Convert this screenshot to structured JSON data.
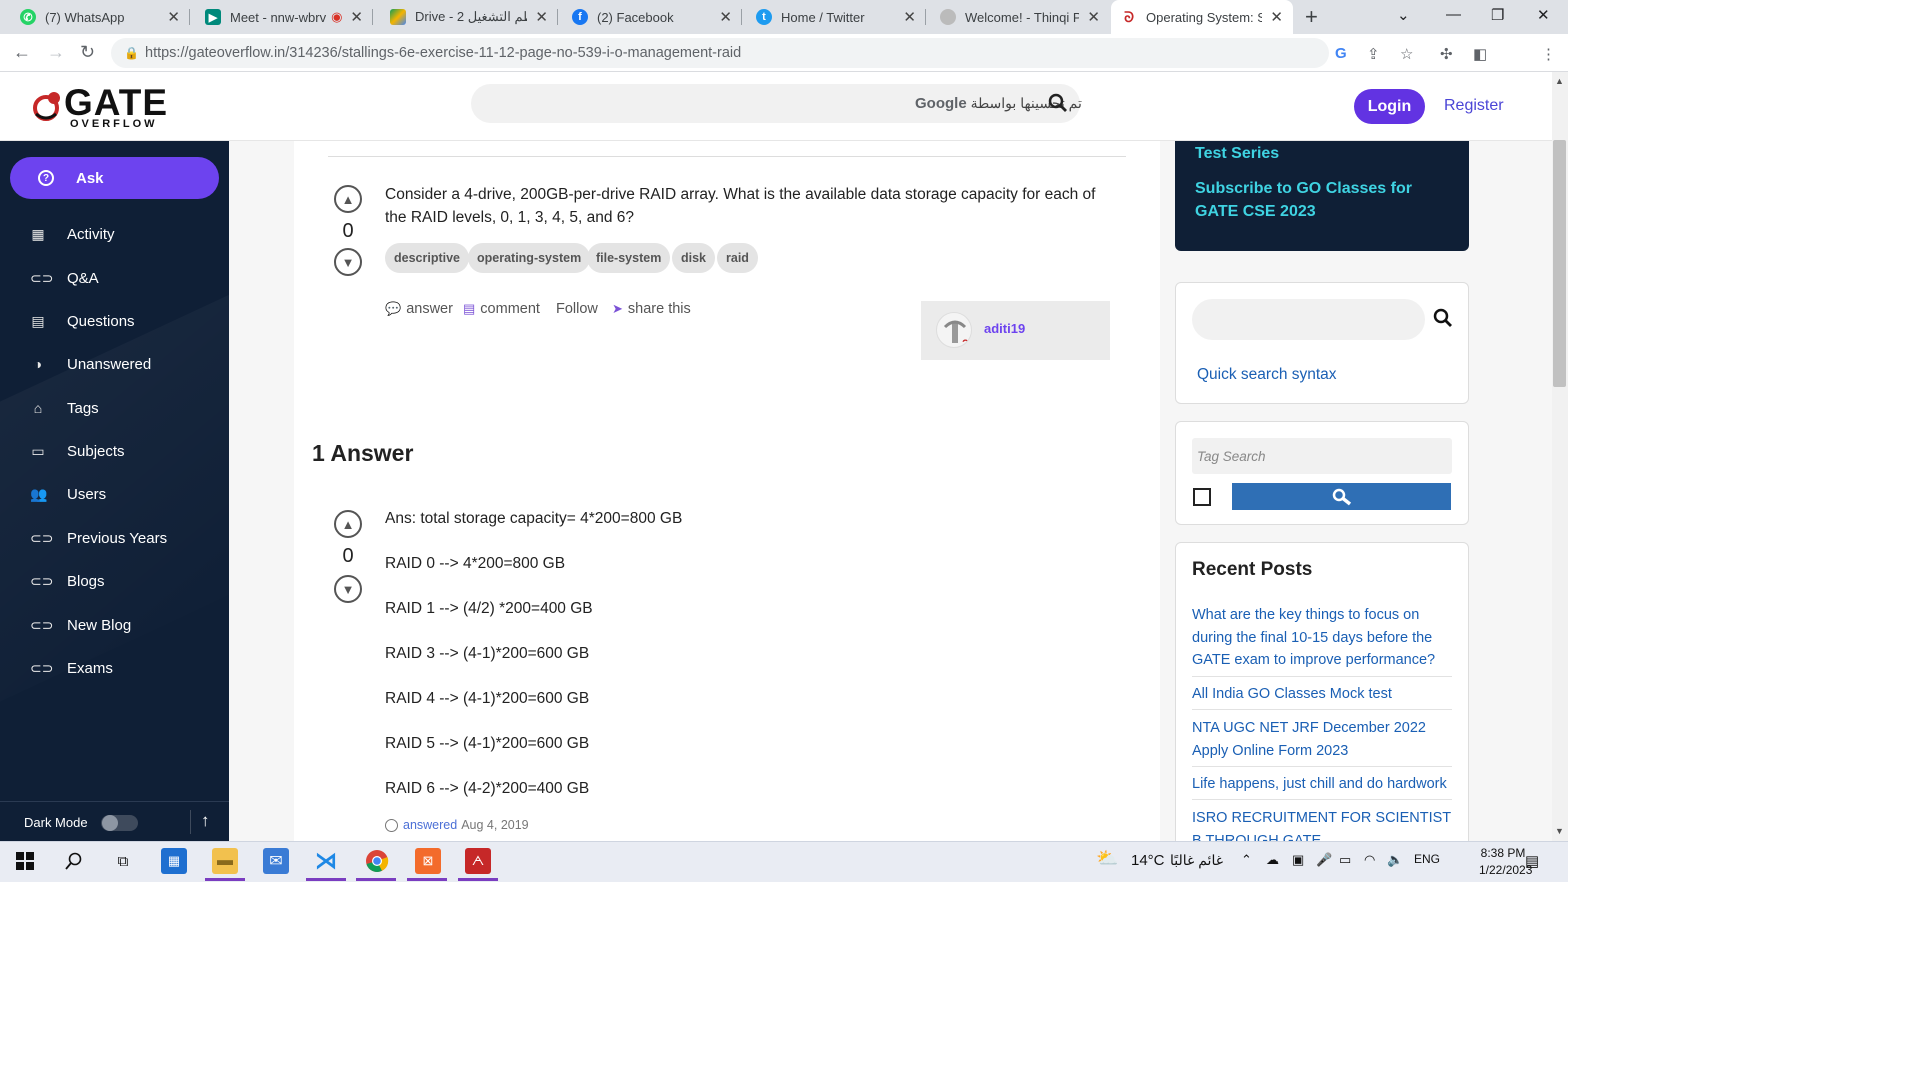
{
  "browser": {
    "tabs": [
      {
        "title": "(7) WhatsApp",
        "icon": "whatsapp-icon"
      },
      {
        "title": "Meet - nnw-wbrv",
        "icon": "google-meet-icon"
      },
      {
        "title": "Drive - نظم التشغيل 2",
        "icon": "google-drive-icon"
      },
      {
        "title": "(2) Facebook",
        "icon": "facebook-icon"
      },
      {
        "title": "Home / Twitter",
        "icon": "twitter-icon"
      },
      {
        "title": "Welcome! - Thinqi Pla",
        "icon": "thinqi-icon"
      },
      {
        "title": "Operating System: St",
        "icon": "gateoverflow-icon",
        "active": true
      }
    ],
    "url_host": "https://gateoverflow.in",
    "url_path": "/314236/stallings-6e-exercise-11-12-page-no-539-i-o-management-raid"
  },
  "header": {
    "logo_text": "GATE",
    "logo_sub": "OVERFLOW",
    "search_brand": "Google",
    "search_powered": "تم تحسينها بواسطة",
    "login_label": "Login",
    "register_label": "Register"
  },
  "sidebar": {
    "ask_label": "Ask",
    "items": [
      {
        "label": "Activity",
        "icon": "chart-icon"
      },
      {
        "label": "Q&A",
        "icon": "link-icon"
      },
      {
        "label": "Questions",
        "icon": "clipboard-icon"
      },
      {
        "label": "Unanswered",
        "icon": "half-circle-icon"
      },
      {
        "label": "Tags",
        "icon": "tag-icon"
      },
      {
        "label": "Subjects",
        "icon": "folder-icon"
      },
      {
        "label": "Users",
        "icon": "users-icon"
      },
      {
        "label": "Previous Years",
        "icon": "link-icon"
      },
      {
        "label": "Blogs",
        "icon": "link-icon"
      },
      {
        "label": "New Blog",
        "icon": "link-icon"
      },
      {
        "label": "Exams",
        "icon": "link-icon"
      }
    ],
    "dark_mode_label": "Dark Mode"
  },
  "question": {
    "votes": "0",
    "text": "Consider a 4-drive, 200GB-per-drive RAID array. What is the available data storage capacity for each of the RAID levels, 0, 1, 3, 4, 5, and 6?",
    "tags": [
      "descriptive",
      "operating-system",
      "file-system",
      "disk",
      "raid"
    ],
    "actions": {
      "answer": "answer",
      "comment": "comment",
      "follow": "Follow",
      "share": "share this"
    },
    "author": "aditi19"
  },
  "answers": {
    "heading": "1 Answer",
    "votes": "0",
    "lines": [
      "Ans: total storage capacity= 4*200=800 GB",
      "RAID 0 --> 4*200=800 GB",
      "RAID 1 --> (4/2) *200=400 GB",
      "RAID 3 --> (4-1)*200=600 GB",
      "RAID 4 --> (4-1)*200=600 GB",
      "RAID 5 --> (4-1)*200=600 GB",
      "RAID 6 --> (4-2)*200=400 GB"
    ],
    "answered_label": "answered",
    "answered_date": "Aug 4, 2019"
  },
  "right": {
    "promo_line1": "Test Series",
    "promo_line2": "Subscribe to GO Classes for GATE CSE 2023",
    "quick_search_label": "Quick search syntax",
    "tag_search_placeholder": "Tag Search",
    "recent_posts_heading": "Recent Posts",
    "recent_posts": [
      "What are the key things to focus on during the final 10-15 days before the GATE exam to improve performance?",
      "All India GO Classes Mock test",
      "NTA UGC NET JRF December 2022 Apply Online Form 2023",
      "Life happens, just chill and do hardwork",
      "ISRO RECRUITMENT FOR SCIENTIST B THROUGH GATE"
    ]
  },
  "taskbar": {
    "weather_temp": "14°C",
    "weather_text": "غائم غالبًا",
    "language": "ENG",
    "time": "8:38 PM",
    "date": "1/22/2023"
  },
  "colors": {
    "accent": "#6d43ef",
    "sidebar_bg": "#0f1f36",
    "promo_text": "#3fd3e2",
    "link": "#1a5fb4"
  }
}
